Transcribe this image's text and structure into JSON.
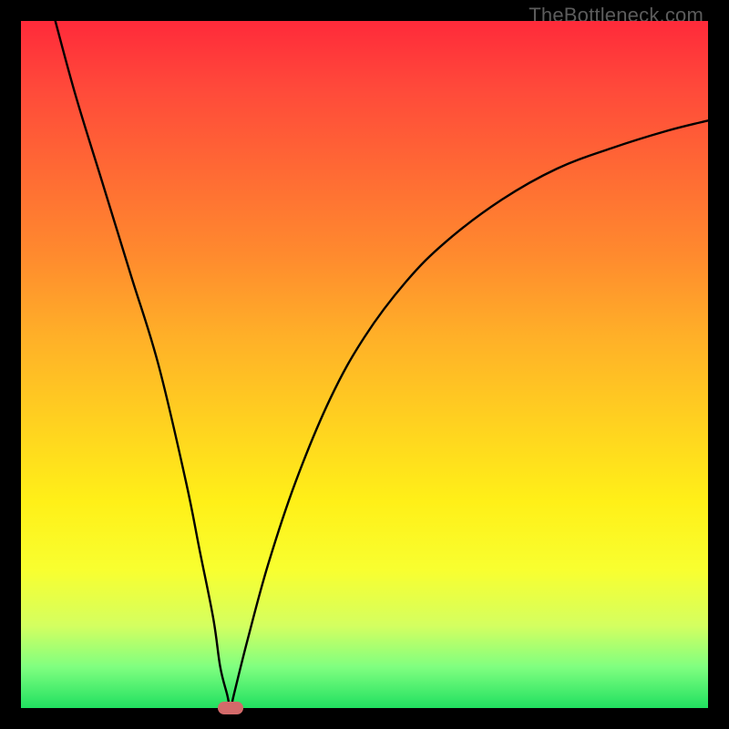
{
  "watermark": "TheBottleneck.com",
  "chart_data": {
    "type": "line",
    "title": "",
    "xlabel": "",
    "ylabel": "",
    "xlim": [
      0,
      100
    ],
    "ylim": [
      0,
      100
    ],
    "grid": false,
    "legend": "none",
    "series": [
      {
        "name": "curve",
        "x": [
          5,
          8,
          12,
          16,
          20,
          24,
          26,
          28,
          29,
          30,
          30.5,
          31,
          33,
          36,
          40,
          45,
          50,
          56,
          62,
          70,
          78,
          86,
          94,
          100
        ],
        "y": [
          100,
          89,
          76,
          63,
          50,
          33,
          23,
          13,
          6,
          2,
          0,
          2,
          10,
          21,
          33,
          45,
          54,
          62,
          68,
          74,
          78.5,
          81.5,
          84,
          85.5
        ]
      }
    ],
    "marker": {
      "x": 30.5,
      "y": 0
    },
    "background_gradient": {
      "top": "#ff2a3a",
      "mid": "#fff018",
      "bottom": "#20e060"
    }
  }
}
